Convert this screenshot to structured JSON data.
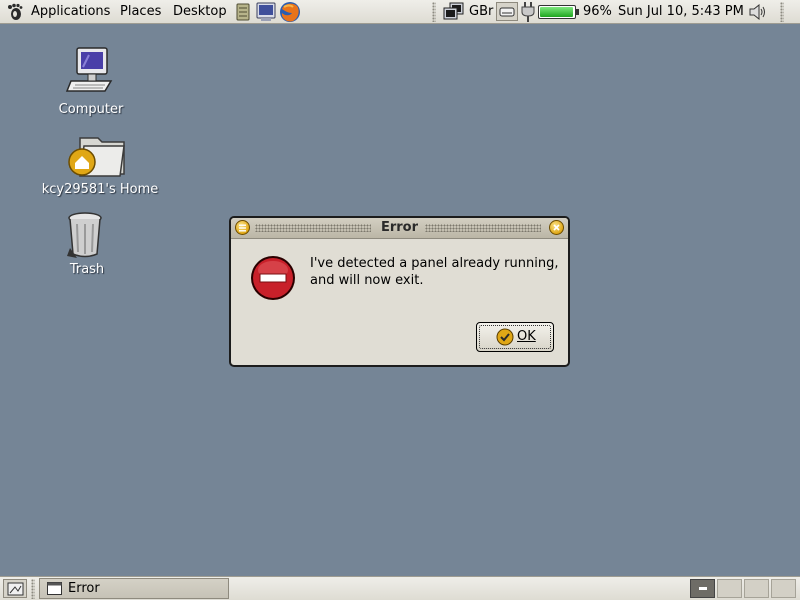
{
  "top_panel": {
    "menus": [
      "Applications",
      "Places",
      "Desktop"
    ],
    "keyboard_layout": "GBr",
    "battery_percent": "96%",
    "battery_level": 0.96,
    "clock": "Sun Jul 10,  5:43 PM"
  },
  "desktop_icons": [
    {
      "label": "Computer",
      "icon": "computer-icon"
    },
    {
      "label": "kcy29581's Home",
      "icon": "home-folder-icon"
    },
    {
      "label": "Trash",
      "icon": "trash-icon"
    }
  ],
  "dialog": {
    "title": "Error",
    "message_line1": "I've detected a panel already running,",
    "message_line2": "and will now exit.",
    "ok_label": "OK",
    "icon": "error-icon"
  },
  "bottom_panel": {
    "task_label": "Error"
  },
  "colors": {
    "desktop": "#758596",
    "panel": "#e6e4dc",
    "error_red": "#c8202a",
    "accent_gold": "#e0a716",
    "battery_green": "#37c837"
  }
}
